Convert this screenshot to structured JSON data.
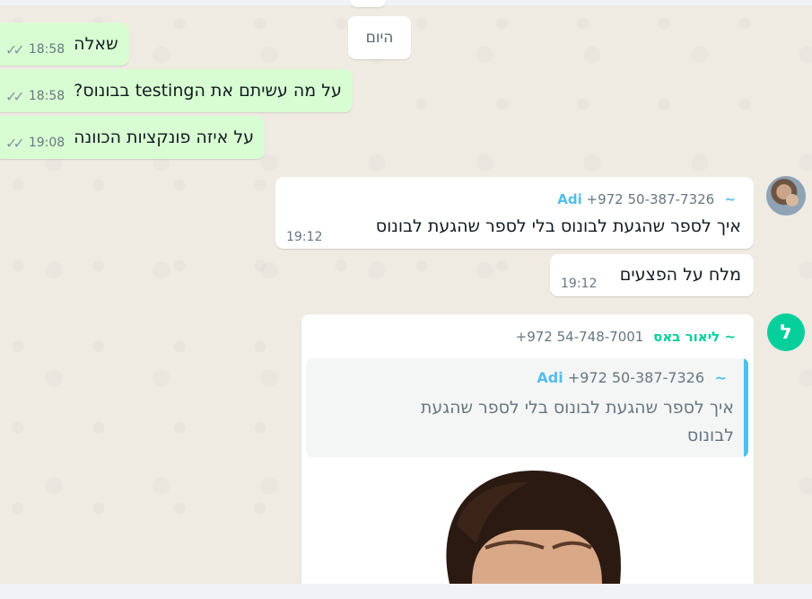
{
  "date_divider": "היום",
  "outgoing": [
    {
      "text": "שאלה",
      "time": "18:58"
    },
    {
      "text": "על מה עשיתם את הtesting בבונוס?",
      "time": "18:58"
    },
    {
      "text": "על איזה פונקציות הכוונה",
      "time": "19:08"
    }
  ],
  "incoming": [
    {
      "sender_name": "~ Adi",
      "sender_phone": "+972 50-387-7326",
      "text": "איך לספר שהגעת לבונוס בלי לספר שהגעת לבונוס",
      "time": "19:12"
    },
    {
      "text": "מלח על הפצעים",
      "time": "19:12"
    }
  ],
  "reply_message": {
    "avatar_letter": "ל",
    "sender_name": "~ ליאור באס",
    "sender_phone": "+972 54-748-7001",
    "quoted": {
      "sender_name": "~ Adi",
      "sender_phone": "+972 50-387-7326",
      "text": "איך לספר שהגעת לבונוס בלי לספר שהגעת לבונוס"
    }
  },
  "colors": {
    "outgoing_bubble": "#d9fdd3",
    "incoming_bubble": "#ffffff",
    "adi_name": "#53bdeb",
    "lior_name": "#06cf9c",
    "quote_bar": "#53bdeb",
    "chat_background": "#efeae2"
  },
  "icons": {
    "read_receipt": "double-check-icon"
  }
}
